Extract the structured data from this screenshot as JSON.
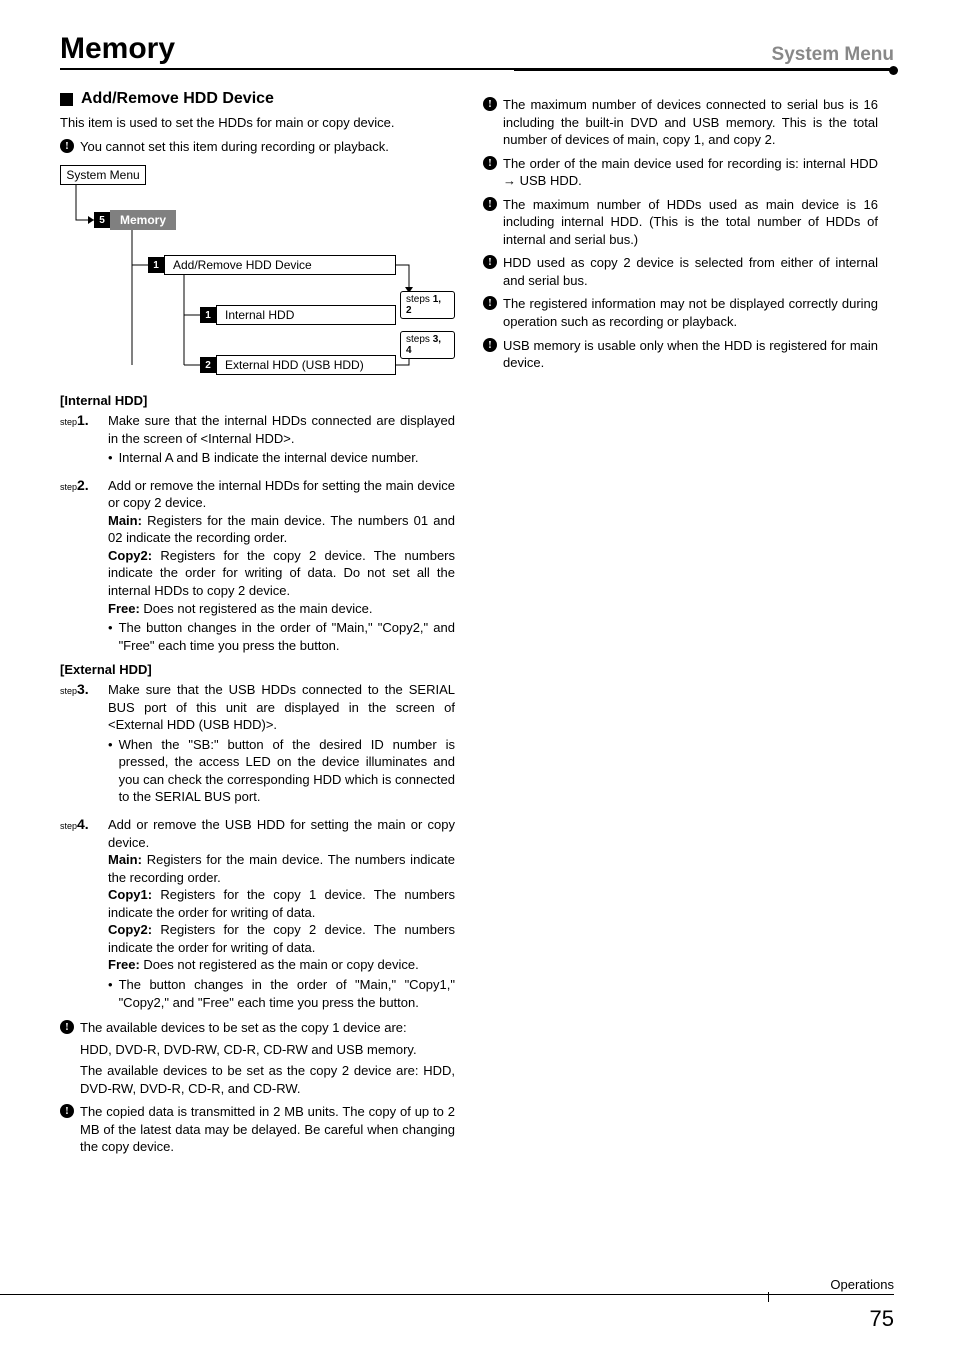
{
  "header": {
    "title": "Memory",
    "right": "System Menu"
  },
  "section": {
    "title": "Add/Remove HDD Device",
    "intro": "This item is used to set the HDDs for main or copy device.",
    "warning": "You cannot set this item during recording or playback."
  },
  "diagram": {
    "system_menu": "System Menu",
    "memory_badge": "5",
    "memory_label": "Memory",
    "add_badge": "1",
    "add_label": "Add/Remove HDD Device",
    "internal_badge": "1",
    "internal_label": "Internal HDD",
    "external_badge": "2",
    "external_label": "External HDD (USB HDD)",
    "steps12_prefix": "steps",
    "steps12": "1, 2",
    "steps34_prefix": "steps",
    "steps34": "3, 4"
  },
  "left": {
    "internal_heading": "[Internal HDD]",
    "step1": {
      "prefix": "step",
      "num": "1.",
      "text": "Make sure that the internal HDDs connected are displayed in the screen of <Internal HDD>.",
      "bullet": "Internal A and B indicate the internal device number."
    },
    "step2": {
      "prefix": "step",
      "num": "2.",
      "text": "Add or remove the internal HDDs for setting the main device or copy 2 device.",
      "main_label": "Main:",
      "main_text": " Registers for the main device. The numbers 01 and 02 indicate the recording order.",
      "copy2_label": "Copy2:",
      "copy2_text": " Registers for the copy 2 device. The numbers indicate the order for writing of data.  Do not set all the internal HDDs to copy 2 device.",
      "free_label": "Free:",
      "free_text": " Does not registered as the main device.",
      "bullet": "The button changes in the order of \"Main,\" \"Copy2,\" and \"Free\" each time you press the button."
    },
    "external_heading": "[External HDD]",
    "step3": {
      "prefix": "step",
      "num": "3.",
      "text": "Make sure that the USB HDDs connected to the SERIAL BUS port of this unit are displayed in the screen of <External HDD (USB HDD)>.",
      "bullet": "When the \"SB:\" button of the desired ID number is pressed, the access LED on the device illuminates and you can check the corresponding HDD which is connected to the SERIAL BUS port."
    },
    "step4": {
      "prefix": "step",
      "num": "4.",
      "text": "Add or remove the USB HDD for setting the main or copy device.",
      "main_label": "Main:",
      "main_text": " Registers for the main device. The numbers indicate the recording order.",
      "copy1_label": "Copy1:",
      "copy1_text": " Registers for the copy 1 device. The numbers indicate the order for writing of data.",
      "copy2_label": "Copy2:",
      "copy2_text": " Registers for the copy 2 device. The numbers indicate the order for writing of data.",
      "free_label": "Free:",
      "free_text": " Does not registered as the main or copy device.",
      "bullet": "The button changes in the order of \"Main,\" \"Copy1,\" \"Copy2,\" and \"Free\" each time you press the button."
    },
    "notice_copy1": {
      "line1": "The available devices to be set as the copy 1 device are:",
      "line2": "HDD, DVD-R, DVD-RW, CD-R, CD-RW and USB memory.",
      "line3": "The available devices to be set as the copy 2 device are: HDD, DVD-RW, DVD-R, CD-R, and CD-RW."
    },
    "notice_2mb": "The copied data is transmitted in 2 MB units. The copy of up to 2 MB of the latest data may be delayed. Be careful when changing the copy device."
  },
  "right_col": {
    "n1": "The maximum number of devices connected to serial bus is 16 including the built-in DVD and USB memory. This is the total number of devices of main, copy 1, and copy 2.",
    "n2": "The order of the main device used for recording is: internal HDD → USB HDD.",
    "n3": "The maximum number of HDDs used as main device is 16 including internal HDD. (This is the total number of HDDs of internal and serial bus.)",
    "n4": "HDD used as copy 2 device is selected from either of internal and serial bus.",
    "n5": "The registered information may not be displayed correctly during operation such as recording or playback.",
    "n6": "USB memory is usable only when the HDD is registered for main device."
  },
  "footer": {
    "label": "Operations",
    "page": "75"
  }
}
